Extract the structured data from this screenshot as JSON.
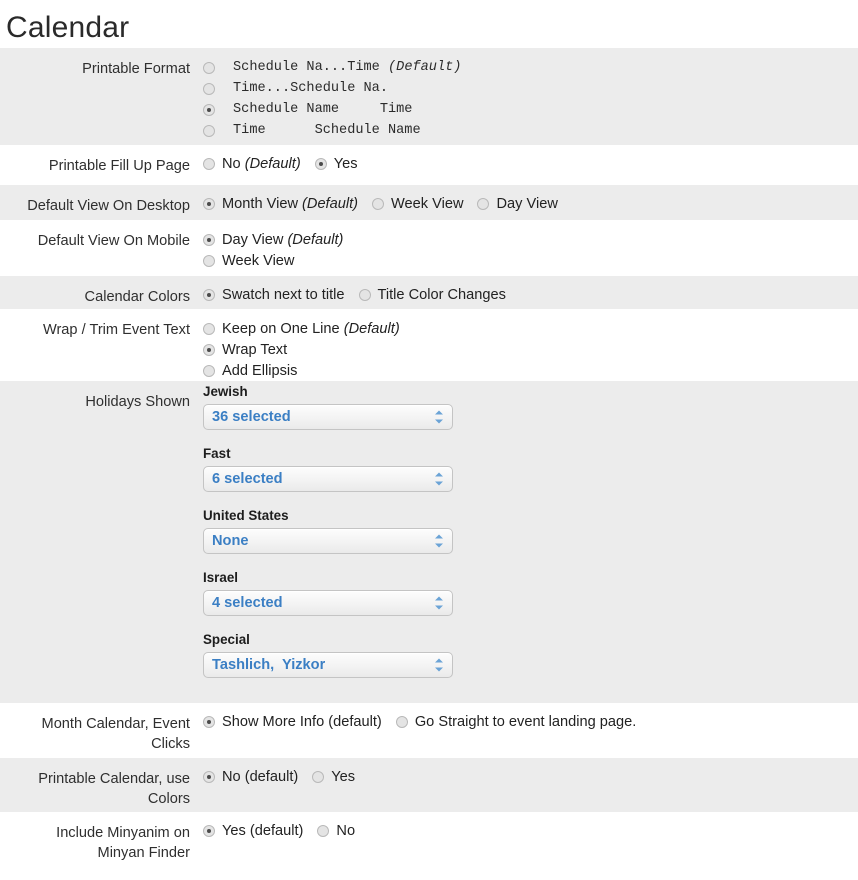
{
  "page": {
    "title": "Calendar"
  },
  "rows": [
    {
      "label": "Printable Format",
      "type": "mono-radio",
      "shaded": true,
      "options": [
        {
          "text": "Schedule Na...Time ",
          "default_tag": "(Default)",
          "checked": false
        },
        {
          "text": "Time...Schedule Na.",
          "default_tag": "",
          "checked": false
        },
        {
          "text": "Schedule Name     Time",
          "default_tag": "",
          "checked": true
        },
        {
          "text": "Time      Schedule Name",
          "default_tag": "",
          "checked": false
        }
      ]
    },
    {
      "label": "Printable Fill Up Page",
      "type": "inline-radio",
      "shaded": false,
      "options": [
        {
          "text": "No ",
          "default_tag": "(Default)",
          "checked": false
        },
        {
          "text": "Yes",
          "default_tag": "",
          "checked": true
        }
      ]
    },
    {
      "label": "Default View On Desktop",
      "type": "inline-radio",
      "shaded": true,
      "options": [
        {
          "text": "Month View ",
          "default_tag": "(Default)",
          "checked": true
        },
        {
          "text": "Week View",
          "default_tag": "",
          "checked": false
        },
        {
          "text": "Day View",
          "default_tag": "",
          "checked": false
        }
      ]
    },
    {
      "label": "Default View On Mobile",
      "type": "stacked-radio",
      "shaded": false,
      "options": [
        {
          "text": "Day View ",
          "default_tag": "(Default)",
          "checked": true
        },
        {
          "text": "Week View",
          "default_tag": "",
          "checked": false
        }
      ]
    },
    {
      "label": "Calendar Colors",
      "type": "inline-radio",
      "shaded": true,
      "options": [
        {
          "text": "Swatch next to title",
          "default_tag": "",
          "checked": true
        },
        {
          "text": "Title Color Changes",
          "default_tag": "",
          "checked": false
        }
      ]
    },
    {
      "label": "Wrap / Trim Event Text",
      "type": "stacked-radio",
      "shaded": false,
      "options": [
        {
          "text": "Keep on One Line ",
          "default_tag": "(Default)",
          "checked": false
        },
        {
          "text": "Wrap Text",
          "default_tag": "",
          "checked": true
        },
        {
          "text": "Add Ellipsis",
          "default_tag": "",
          "checked": false
        }
      ]
    },
    {
      "label": "Holidays Shown",
      "type": "selects",
      "shaded": true,
      "groups": [
        {
          "title": "Jewish",
          "value": "36 selected"
        },
        {
          "title": "Fast",
          "value": "6 selected"
        },
        {
          "title": "United States",
          "value": "None"
        },
        {
          "title": "Israel",
          "value": "4 selected"
        },
        {
          "title": "Special",
          "value": "Tashlich,  Yizkor"
        }
      ]
    },
    {
      "label": "Month Calendar, Event\nClicks",
      "type": "inline-radio",
      "shaded": false,
      "options": [
        {
          "text": "Show More Info (default)",
          "default_tag": "",
          "checked": true
        },
        {
          "text": "Go Straight to event landing page.",
          "default_tag": "",
          "checked": false
        }
      ]
    },
    {
      "label": "Printable Calendar, use\nColors",
      "type": "inline-radio",
      "shaded": true,
      "options": [
        {
          "text": "No (default)",
          "default_tag": "",
          "checked": true
        },
        {
          "text": "Yes",
          "default_tag": "",
          "checked": false
        }
      ]
    },
    {
      "label": "Include Minyanim on\nMinyan Finder",
      "type": "inline-radio",
      "shaded": false,
      "options": [
        {
          "text": "Yes (default)",
          "default_tag": "",
          "checked": true
        },
        {
          "text": "No",
          "default_tag": "",
          "checked": false
        }
      ]
    }
  ]
}
